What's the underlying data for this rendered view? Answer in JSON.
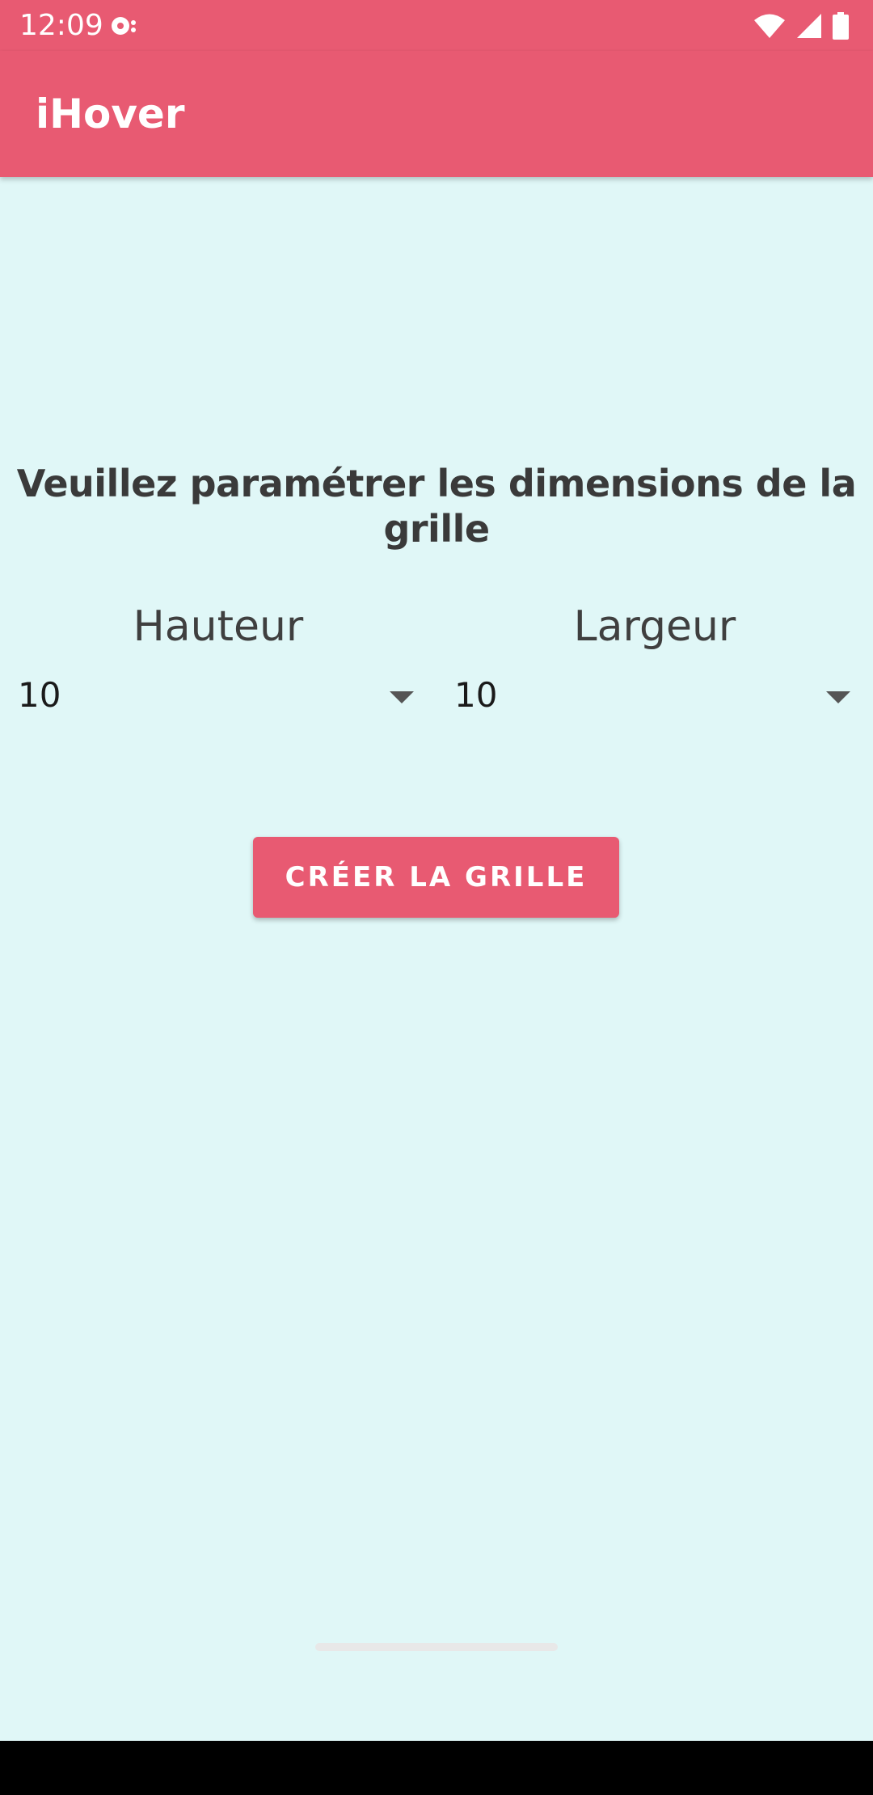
{
  "status_bar": {
    "time": "12:09",
    "icons": [
      "notification-icon",
      "wifi-icon",
      "signal-icon",
      "battery-icon"
    ]
  },
  "app_bar": {
    "title": "iHover"
  },
  "main": {
    "instruction": "Veuillez paramétrer les dimensions de la grille",
    "height_label": "Hauteur",
    "width_label": "Largeur",
    "height_value": "10",
    "width_value": "10",
    "create_button": "CRÉER LA GRILLE"
  },
  "colors": {
    "primary": "#e85a72",
    "background": "#e0f7f7",
    "text_dark": "#3a3a3a"
  }
}
